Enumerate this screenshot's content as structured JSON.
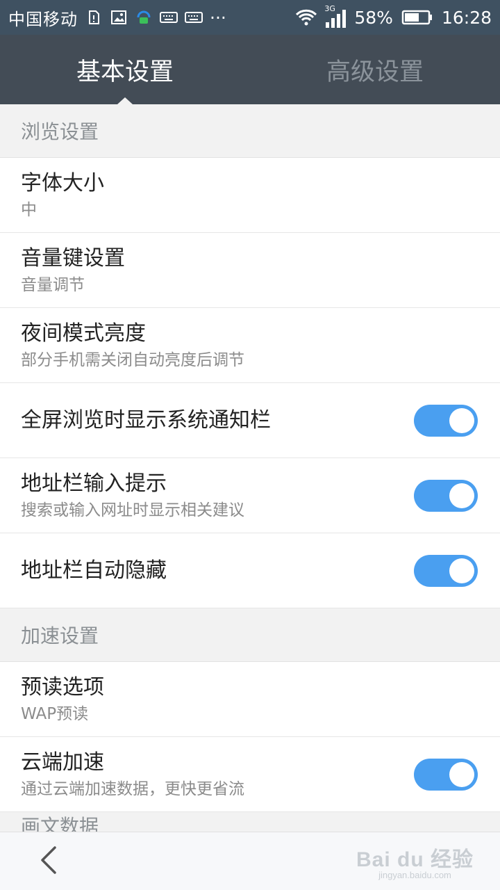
{
  "status_bar": {
    "carrier": "中国移动",
    "network": "3G",
    "battery": "58%",
    "time": "16:28",
    "more": "···"
  },
  "tabs": [
    {
      "label": "基本设置",
      "active": true
    },
    {
      "label": "高级设置",
      "active": false
    }
  ],
  "sections": {
    "browse": {
      "header": "浏览设置",
      "items": [
        {
          "title": "字体大小",
          "subtitle": "中"
        },
        {
          "title": "音量键设置",
          "subtitle": "音量调节"
        },
        {
          "title": "夜间模式亮度",
          "subtitle": "部分手机需关闭自动亮度后调节"
        },
        {
          "title": "全屏浏览时显示系统通知栏",
          "toggle": true
        },
        {
          "title": "地址栏输入提示",
          "subtitle": "搜索或输入网址时显示相关建议",
          "toggle": true
        },
        {
          "title": "地址栏自动隐藏",
          "toggle": true
        }
      ]
    },
    "speed": {
      "header": "加速设置",
      "items": [
        {
          "title": "预读选项",
          "subtitle": "WAP预读"
        },
        {
          "title": "云端加速",
          "subtitle": "通过云端加速数据，更快更省流",
          "toggle": true
        }
      ]
    },
    "next": {
      "header": "画文数据"
    }
  },
  "watermark": {
    "main": "Bai du 经验",
    "sub": "jingyan.baidu.com"
  },
  "colors": {
    "status_bg": "#3f5161",
    "tab_bg": "#434c56",
    "toggle_on": "#4a9ff0"
  }
}
